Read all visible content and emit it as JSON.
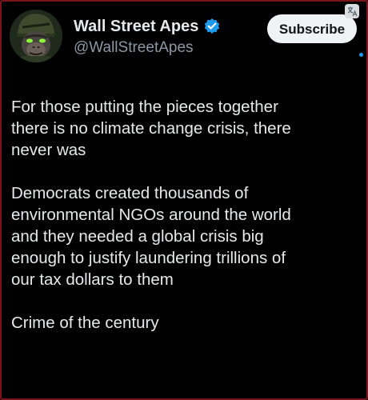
{
  "author": {
    "display_name": "Wall Street Apes",
    "handle": "@WallStreetApes",
    "verified": true
  },
  "header": {
    "subscribe_label": "Subscribe"
  },
  "colors": {
    "background": "#000000",
    "text": "#e7e9ea",
    "secondary_text": "#8b98a5",
    "verified_blue": "#1d9bf0",
    "frame_border": "#7a1418"
  },
  "tweet": {
    "paragraphs": [
      "For those putting the pieces together\nthere is no climate change crisis, there\nnever was",
      "Democrats created thousands of\nenvironmental NGOs around the world\nand they needed a global crisis big\nenough to justify laundering trillions of\nour tax dollars to them",
      "Crime of the century"
    ]
  }
}
